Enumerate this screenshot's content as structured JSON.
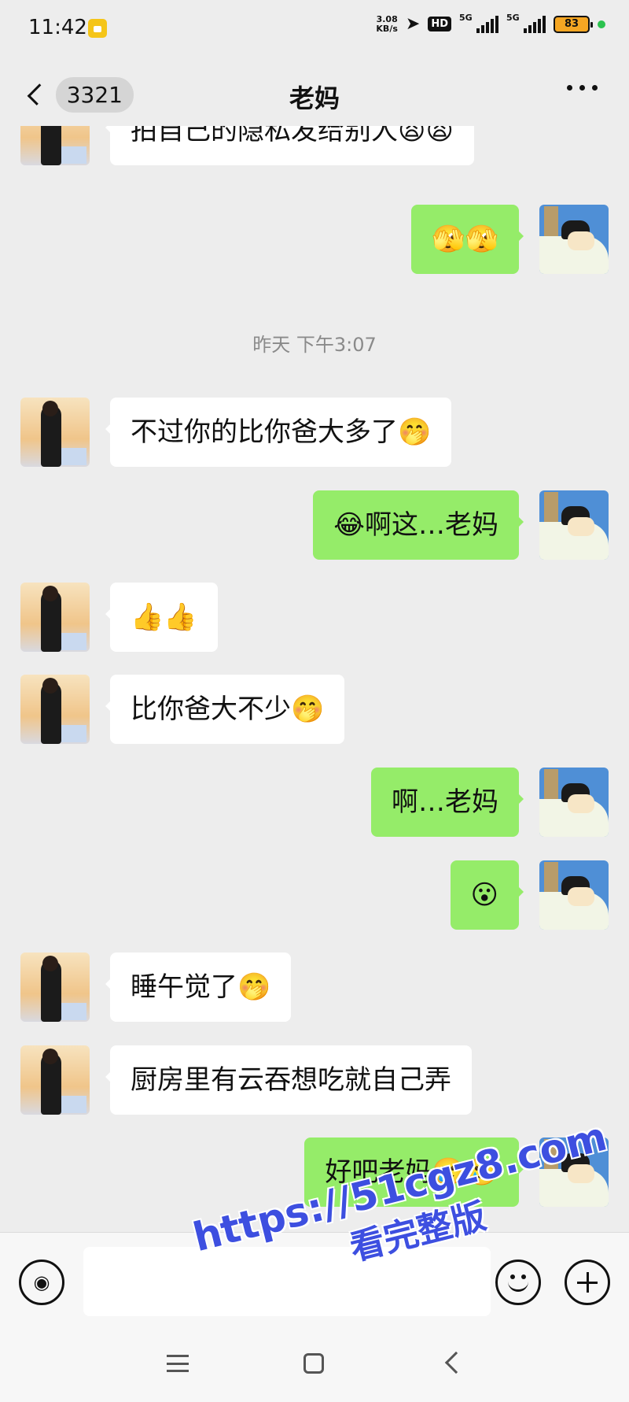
{
  "status_bar": {
    "time": "11:42",
    "net_speed_value": "3.08",
    "net_speed_unit": "KB/s",
    "hd_label": "HD",
    "signal1_label": "5G",
    "signal2_label": "5G",
    "battery_level": "83"
  },
  "header": {
    "back_unread_count": "3321",
    "title": "老妈"
  },
  "messages": [
    {
      "from": "mom",
      "text": "拍自己的隐私发给别人😫😫"
    },
    {
      "from": "me",
      "text": "🫣🫣"
    },
    {
      "timestamp": "昨天 下午3:07"
    },
    {
      "from": "mom",
      "text": "不过你的比你爸大多了🤭"
    },
    {
      "from": "me",
      "text": "😂啊这…老妈"
    },
    {
      "from": "mom",
      "text": "👍👍"
    },
    {
      "from": "mom",
      "text": "比你爸大不少🤭"
    },
    {
      "from": "me",
      "text": "啊…老妈"
    },
    {
      "from": "me",
      "text": "😮"
    },
    {
      "from": "mom",
      "text": "睡午觉了🤭"
    },
    {
      "from": "mom",
      "text": "厨房里有云吞想吃就自己弄"
    },
    {
      "from": "me",
      "text": "好吧老妈🥲🥲"
    }
  ],
  "input_bar": {
    "placeholder": ""
  },
  "watermark": {
    "url": "https://51cgz8.com",
    "subtitle": "看完整版"
  },
  "colors": {
    "background": "#ededed",
    "incoming_bubble": "#ffffff",
    "outgoing_bubble": "#95ec69",
    "watermark": "#3d4fe0"
  }
}
